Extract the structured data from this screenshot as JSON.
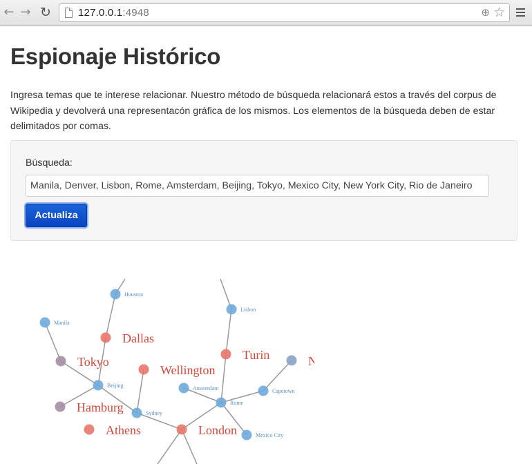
{
  "browser": {
    "url_host": "127.0.0.1",
    "url_port": ":4948"
  },
  "page": {
    "title": "Espionaje Histórico",
    "intro": "Ingresa temas que te interese relacionar. Nuestro método de búsqueda relacionará estos a través del corpus de Wikipedia y devolverá una representacón gráfica de los mismos. Los elementos de la búsqueda deben de estar delimitados por comas."
  },
  "search": {
    "label": "Búsqueda:",
    "value": "Manila, Denver, Lisbon, Rome, Amsterdam, Beijing, Tokyo, Mexico City, New York City, Rio de Janeiro",
    "button": "Actualiza"
  },
  "colors": {
    "blue_node": "#6fa8dc",
    "red_node": "#e8756a",
    "purple_node": "#a58ea3",
    "slate_node": "#8aa2c4",
    "edge": "#999999",
    "big_label": "#d04a3c",
    "small_label": "#5a8fc8"
  },
  "graph": {
    "nodes": [
      {
        "id": "houston",
        "label": "Houston",
        "kind": "blue"
      },
      {
        "id": "manila",
        "label": "Manila",
        "kind": "blue"
      },
      {
        "id": "dallas",
        "label": "Dallas",
        "kind": "red"
      },
      {
        "id": "tokyo",
        "label": "Tokyo",
        "kind": "purple"
      },
      {
        "id": "beijing",
        "label": "Beijing",
        "kind": "blue"
      },
      {
        "id": "hamburg",
        "label": "Hamburg",
        "kind": "purple"
      },
      {
        "id": "athens",
        "label": "Athens",
        "kind": "red"
      },
      {
        "id": "wellington",
        "label": "Wellington",
        "kind": "red"
      },
      {
        "id": "sydney",
        "label": "Sydney",
        "kind": "blue"
      },
      {
        "id": "london",
        "label": "London",
        "kind": "red"
      },
      {
        "id": "amsterdam",
        "label": "Amsterdam",
        "kind": "blue"
      },
      {
        "id": "rome",
        "label": "Rome",
        "kind": "blue"
      },
      {
        "id": "lisbon",
        "label": "Lisbon",
        "kind": "blue"
      },
      {
        "id": "turin",
        "label": "Turin",
        "kind": "red"
      },
      {
        "id": "capetown",
        "label": "Capetown",
        "kind": "blue"
      },
      {
        "id": "ny",
        "label": "N",
        "kind": "slate"
      },
      {
        "id": "mexico",
        "label": "Mexico City",
        "kind": "blue"
      }
    ]
  }
}
